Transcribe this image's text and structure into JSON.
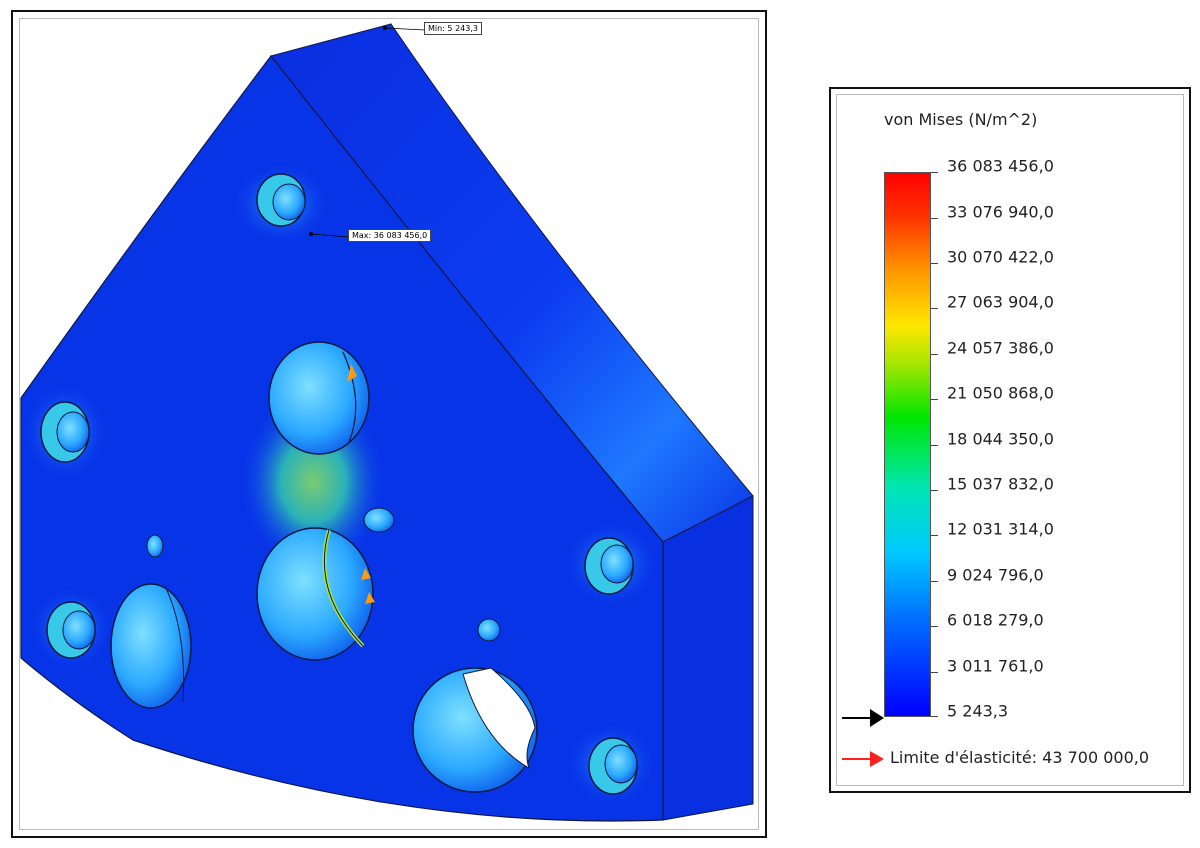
{
  "model": {
    "probe_min_label": "Min: 5 243,3",
    "probe_max_label": "Max: 36 083 456,0"
  },
  "legend": {
    "title": "von Mises (N/m^2)",
    "ticks": [
      "36 083 456,0",
      "33 076 940,0",
      "30 070 422,0",
      "27 063 904,0",
      "24 057 386,0",
      "21 050 868,0",
      "18 044 350,0",
      "15 037 832,0",
      "12 031 314,0",
      "9 024 796,0",
      "6 018 279,0",
      "3 011 761,0",
      "5 243,3"
    ],
    "yield_label": "Limite d'élasticité: 43 700 000,0",
    "colors": {
      "min": "#0000ff",
      "max": "#ff0000",
      "yield_arrow": "#ff0000",
      "min_arrow": "#000000"
    }
  }
}
